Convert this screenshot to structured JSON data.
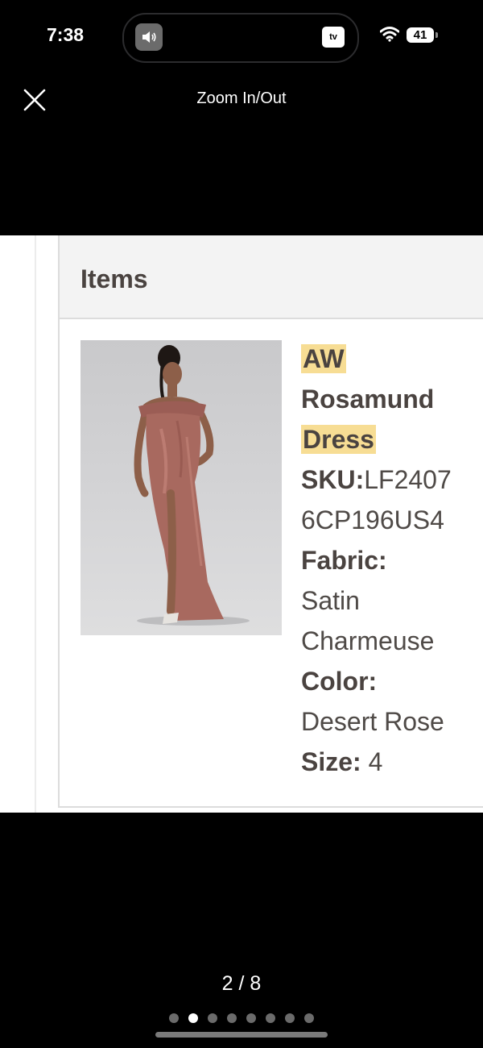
{
  "status_bar": {
    "time": "7:38",
    "tv_label": "tv",
    "battery": "41"
  },
  "viewer": {
    "title": "Zoom In/Out",
    "page_counter": "2 / 8",
    "total_dots": 8,
    "active_dot": 1
  },
  "items_card": {
    "header": "Items",
    "product": {
      "name_parts": [
        "AW",
        "Rosamund",
        "Dress"
      ],
      "sku_label": "SKU:",
      "sku_value_line1": "LF2407",
      "sku_value_line2": "6CP196US4",
      "fabric_label": "Fabric:",
      "fabric_line1": "Satin",
      "fabric_line2": "Charmeuse",
      "color_label": "Color:",
      "color_value": "Desert Rose",
      "size_label": "Size:",
      "size_value": "4"
    }
  },
  "colors": {
    "highlight": "#f7dd94",
    "dress": "#a8695f",
    "text": "#4a4340"
  },
  "icons": {
    "close": "close-icon",
    "volume": "speaker-icon",
    "wifi": "wifi-icon"
  }
}
